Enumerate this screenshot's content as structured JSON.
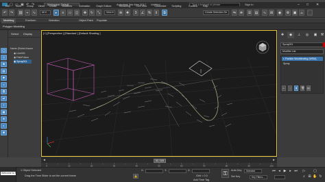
{
  "title_bar": {
    "workspace": "Workspace: Default",
    "app_title": "Autodesk 3ds Max 2017",
    "document": "Untitled",
    "search_placeholder": "Type a keyword or phrase",
    "sign_in": "Sign In"
  },
  "menu": {
    "items": [
      "Edit",
      "Tools",
      "Group",
      "Views",
      "Create",
      "Modifiers",
      "Animation",
      "Graph Editors",
      "Rendering",
      "Civil View",
      "Customize",
      "Scripting",
      "Content",
      "Help"
    ]
  },
  "toolbar": {
    "create_selection_set": "Create Selection Se"
  },
  "ribbon": {
    "tabs": [
      "Modeling",
      "Freeform",
      "Selection",
      "Object Paint",
      "Populate"
    ],
    "active_tab": "Modeling",
    "polygon_label": "Polygon Modeling"
  },
  "scene_explorer": {
    "tabs": [
      "Select",
      "Display"
    ],
    "sort_label": "Name (Sorted Ascen",
    "items": [
      "Line001",
      "PathFollow",
      "Spray001"
    ],
    "selected_item": "Spray001"
  },
  "viewport": {
    "label": "[+] [Perspective ] [Standard ] [Default Shading ]"
  },
  "command_panel": {
    "object_name": "Spray001",
    "modifier_list": "Modifier List",
    "stack_items": [
      "Particle Wordbinding (WSM)",
      "Spray"
    ],
    "stack_selected": "Particle Wordbinding (WSM)"
  },
  "timeline": {
    "thumb_label": "52 / 100",
    "ticks": [
      "0",
      "10",
      "20",
      "30",
      "40",
      "50",
      "60",
      "70",
      "80",
      "90",
      "100"
    ]
  },
  "status": {
    "selection": "1 Object Selected",
    "prompt": "Drag the Time Slider to set the current frame",
    "x_label": "X:",
    "y_label": "Y:",
    "z_label": "Z:",
    "grid": "Grid = 0.0",
    "add_time_tag": "Add Time Tag",
    "auto_key": "Auto Key",
    "selected": "Selected",
    "set_key": "Set Key",
    "key_filters": "Key Filters...",
    "welcome": "Welcome to M"
  }
}
